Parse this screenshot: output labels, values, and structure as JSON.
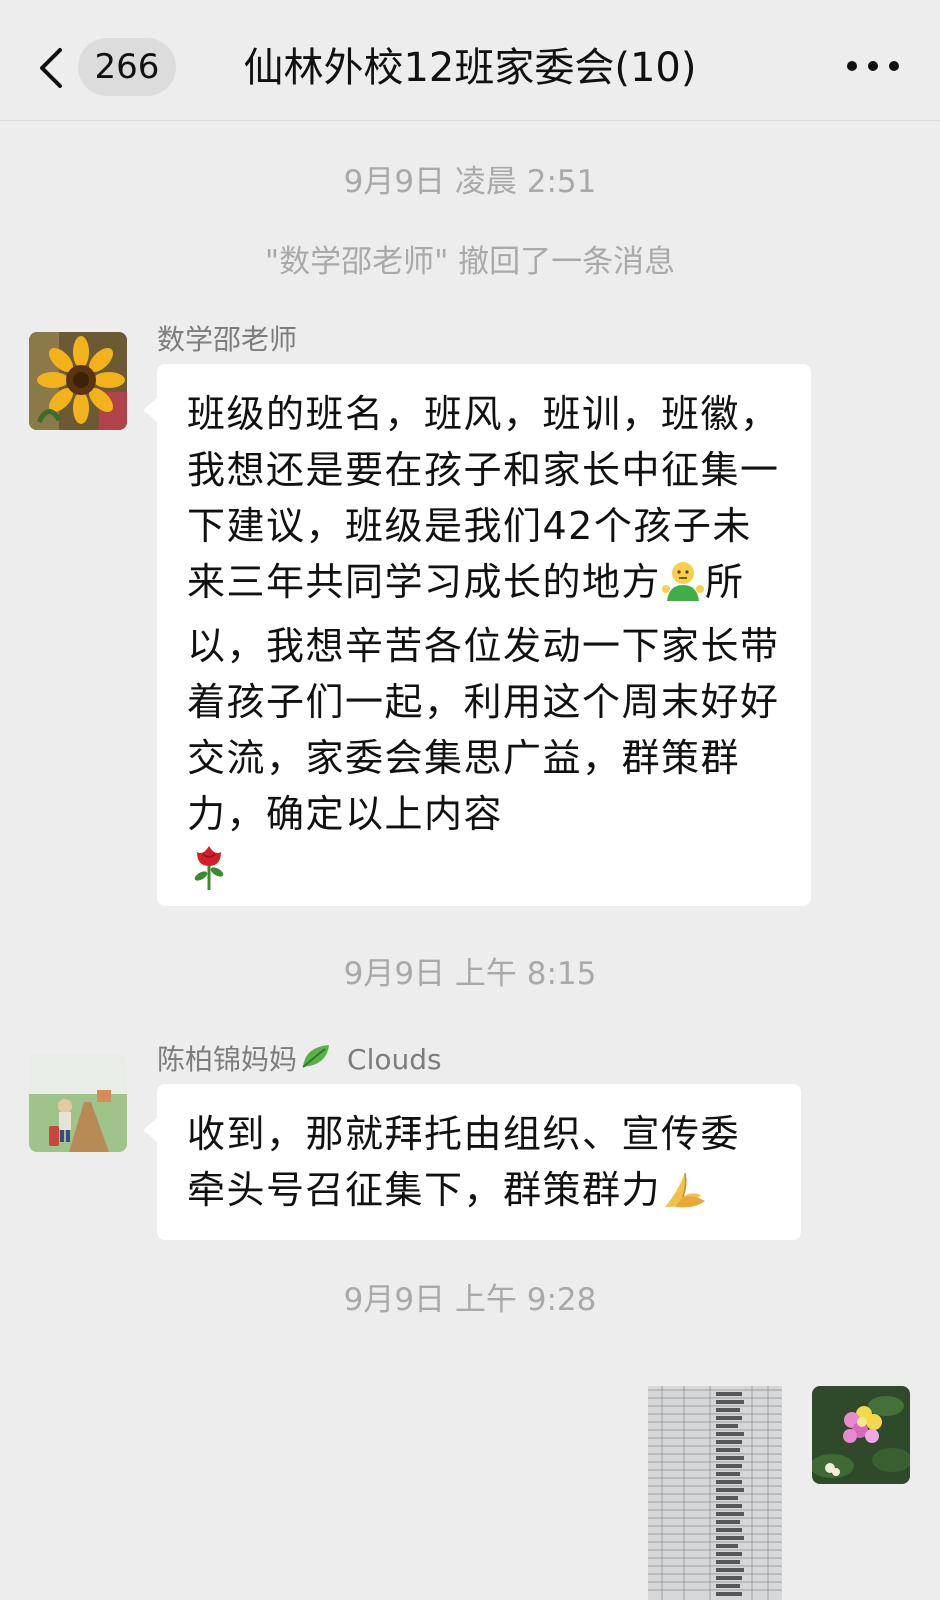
{
  "header": {
    "unread_count": "266",
    "title": "仙林外校12班家委会(10)"
  },
  "messages": {
    "time1": "9月9日 凌晨 2:51",
    "recall_notice": "\"数学邵老师\" 撤回了一条消息",
    "msg1": {
      "sender": "数学邵老师",
      "text_part1": "班级的班名，班风，班训，班徽，我想还是要在孩子和家长中征集一下建议，班级是我们42个孩子未来三年共同学习成长的地方",
      "text_part2": "所以，我想辛苦各位发动一下家长带着孩子们一起，利用这个周末好好交流，家委会集思广益，群策群力，确定以上内容",
      "emoji1": "person-shrug-icon",
      "emoji2": "rose-icon"
    },
    "time2": "9月9日 上午 8:15",
    "msg2": {
      "sender": "陈柏锦妈妈",
      "sender_suffix": "Clouds",
      "text": "收到，那就拜托由组织、宣传委牵头号召征集下，群策群力",
      "emoji": "folded-hands-icon"
    },
    "time3": "9月9日 上午 9:28"
  },
  "colors": {
    "background": "#ededed",
    "bubble": "#ffffff",
    "meta_text": "#a9a9a9"
  }
}
